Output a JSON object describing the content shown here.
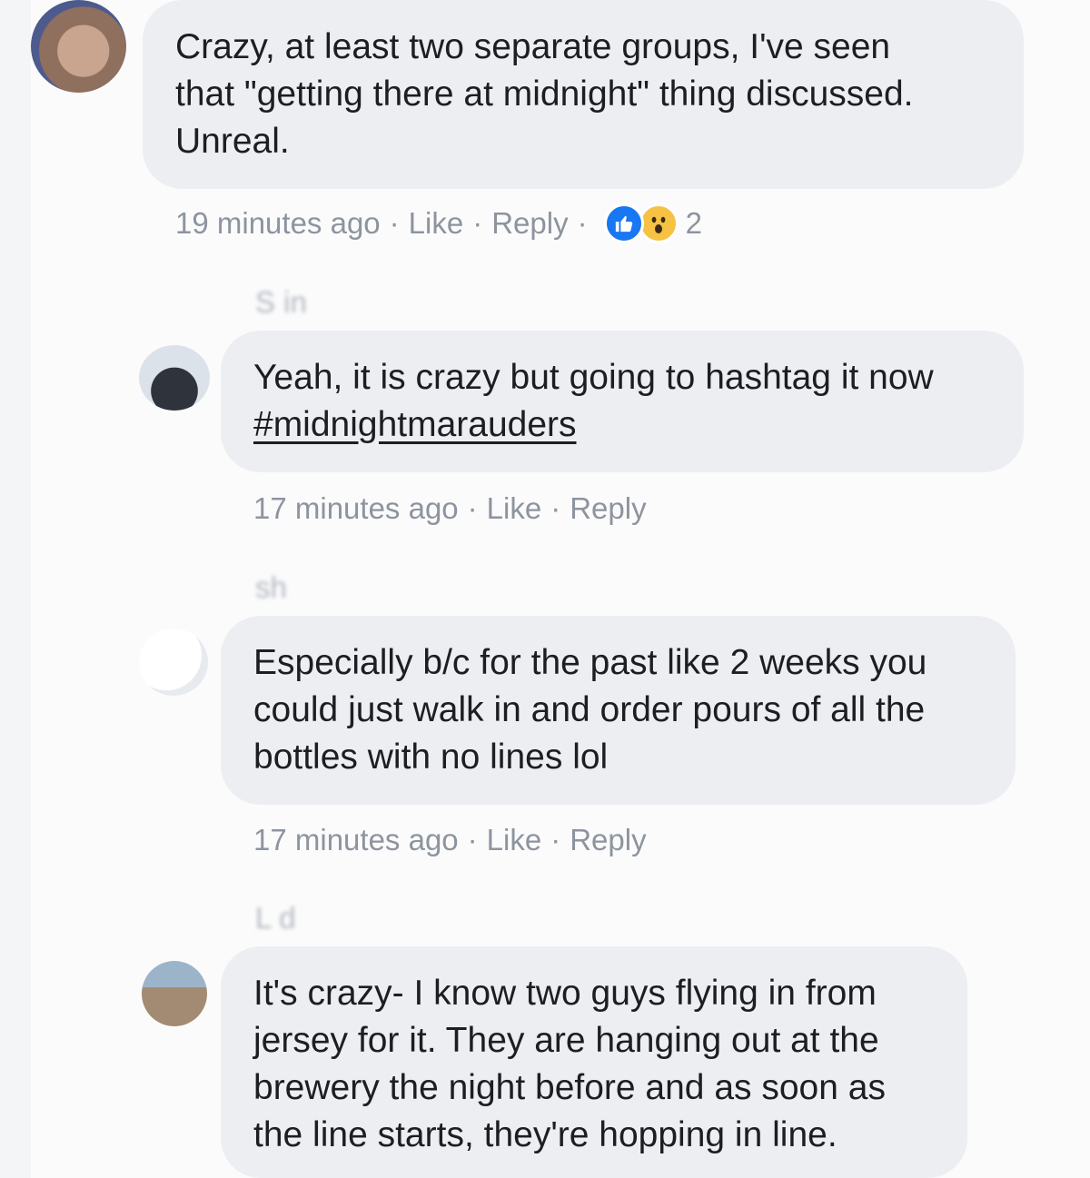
{
  "comments": [
    {
      "author": "",
      "text_lines": [
        "Crazy, at least two separate groups, I've seen",
        "that \"getting there at midnight\" thing discussed.",
        "Unreal."
      ],
      "timestamp": "19 minutes ago",
      "like_label": "Like",
      "reply_label": "Reply",
      "reactions": {
        "icons": [
          "like-icon",
          "wow-icon"
        ],
        "count": "2",
        "like_color": "#1877f2",
        "wow_color": "#f7c144"
      }
    },
    {
      "author_visible": "S          in",
      "text_lines": [
        "Yeah, it is crazy but going to hashtag it now"
      ],
      "hashtag": "#midnightmarauders",
      "timestamp": "17 minutes ago",
      "like_label": "Like",
      "reply_label": "Reply"
    },
    {
      "author_visible": "  sh  ",
      "text_lines": [
        "Especially b/c for the past like 2 weeks you",
        "could just walk in and order pours of all the",
        "bottles with no lines lol"
      ],
      "timestamp": "17 minutes ago",
      "like_label": "Like",
      "reply_label": "Reply"
    },
    {
      "author_visible": "L       d",
      "text_lines": [
        "It's crazy- I know two guys flying in from",
        "jersey for it. They are hanging out at the",
        "brewery the night before and as soon as",
        "the line starts, they're hopping in line."
      ]
    }
  ],
  "separator": "·",
  "colors": {
    "bubble": "#eceef2",
    "meta_text": "#8d949e",
    "text": "#1c1e21"
  }
}
